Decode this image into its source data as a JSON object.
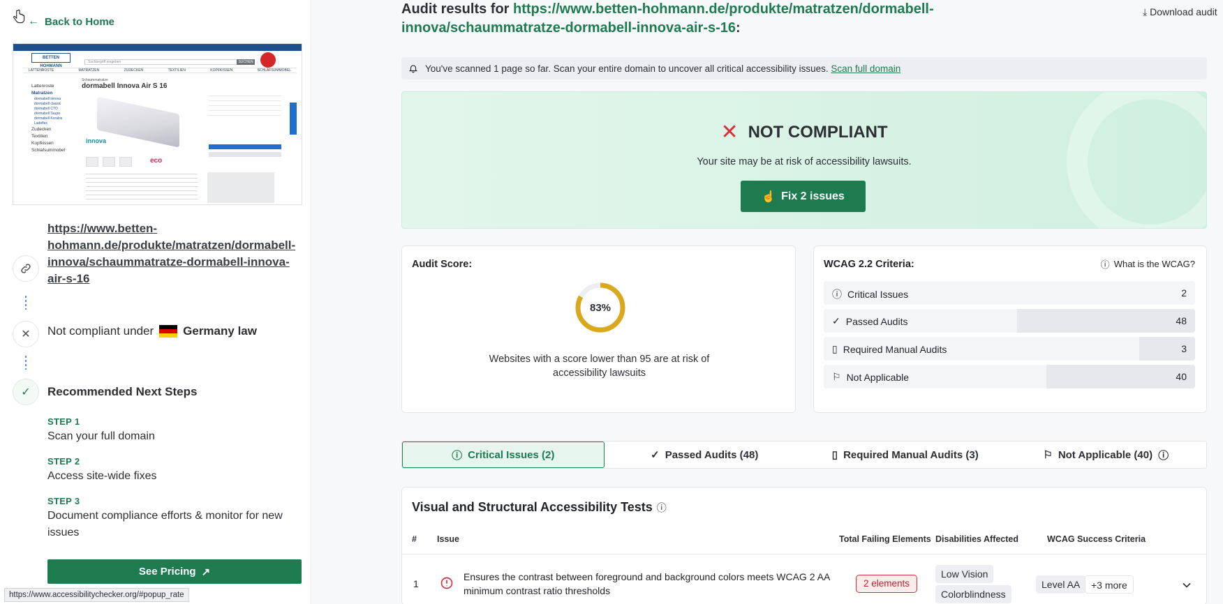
{
  "left": {
    "back_label": "Back to Home",
    "scanned_url": "https://www.betten-hohmann.de/produkte/matratzen/dormabell-innova/schaummatratze-dormabell-innova-air-s-16",
    "law_prefix": "Not compliant under",
    "law_country": "Germany law",
    "flag_colors": [
      "#000000",
      "#dd0000",
      "#ffce00"
    ],
    "steps_title": "Recommended Next Steps",
    "steps": [
      {
        "label": "STEP 1",
        "text": "Scan your full domain"
      },
      {
        "label": "STEP 2",
        "text": "Access site-wide fixes"
      },
      {
        "label": "STEP 3",
        "text": "Document compliance efforts & monitor for new issues"
      }
    ],
    "pricing_label": "See Pricing",
    "status_url": "https://www.accessibilitychecker.org/#popup_rate",
    "preview": {
      "logo": "BETTEN HOHMANN",
      "search_placeholder": "Suchbegriff eingeben",
      "search_button": "SUCHEN",
      "nav": [
        "LATTENROSTE",
        "MATRATZEN",
        "ZUDECKEN",
        "TEXTILIEN",
        "KOPFKISSEN",
        "SCHLAFSUMMOBEL"
      ],
      "side": [
        "Lattenroste",
        "Matratzen",
        "Zudecken",
        "Textilien",
        "Kopfkissen",
        "Schlafsummobel"
      ],
      "sub": [
        "dormabell innova",
        "dormabell classic",
        "dormabell CTO",
        "dormabell Taupo",
        "dormabell Koralos",
        "Ladeflex"
      ],
      "category": "Schaummatratze",
      "product": "dormabell Innova Air S 16",
      "brand": "innova",
      "eco": "eco"
    }
  },
  "main": {
    "title_prefix": "Audit results for",
    "title_url": "https://www.betten-hohmann.de/produkte/matratzen/dormabell-innova/schaummatratze-dormabell-innova-air-s-16",
    "title_suffix": ":",
    "download_label": "Download audit",
    "notice_text": "You've scanned 1 page so far. Scan your entire domain to uncover all critical accessibility issues.",
    "notice_link": "Scan full domain",
    "status": "NOT COMPLIANT",
    "risk_text": "Your site may be at risk of accessibility lawsuits.",
    "fix_label": "Fix 2 issues",
    "score_label": "Audit Score:",
    "score": 83,
    "score_text": "83%",
    "score_note": "Websites with a score lower than 95 are at risk of accessibility lawsuits",
    "wcag_label": "WCAG 2.2 Criteria:",
    "wcag_help": "What is the WCAG?",
    "criteria": [
      {
        "name": "Critical Issues",
        "count": "2",
        "icon": "alert-circle-icon",
        "fill_percent": 0
      },
      {
        "name": "Passed Audits",
        "count": "48",
        "icon": "check-icon",
        "fill_percent": 48
      },
      {
        "name": "Required Manual Audits",
        "count": "3",
        "icon": "document-icon",
        "fill_percent": 15
      },
      {
        "name": "Not Applicable",
        "count": "40",
        "icon": "flag-icon",
        "fill_percent": 40
      }
    ],
    "tabs": [
      {
        "label": "Critical Issues (2)",
        "icon": "alert-circle-icon"
      },
      {
        "label": "Passed Audits (48)",
        "icon": "check-icon"
      },
      {
        "label": "Required Manual Audits (3)",
        "icon": "document-icon"
      },
      {
        "label": "Not Applicable (40)",
        "icon": "flag-icon"
      }
    ],
    "tests_title": "Visual and Structural Accessibility Tests",
    "columns": [
      "#",
      "Issue",
      "Total Failing Elements",
      "Disabilities Affected",
      "WCAG Success Criteria"
    ],
    "rows": [
      {
        "num": "1",
        "issue": "Ensures the contrast between foreground and background colors meets WCAG 2 AA minimum contrast ratio thresholds",
        "failing": "2 elements",
        "disabilities": [
          "Low Vision",
          "Colorblindness"
        ],
        "level": "Level AA",
        "more": "+3 more"
      }
    ]
  },
  "colors": {
    "brand": "#1e7a4f",
    "danger": "#d6313b",
    "score": "#d9a81c"
  }
}
